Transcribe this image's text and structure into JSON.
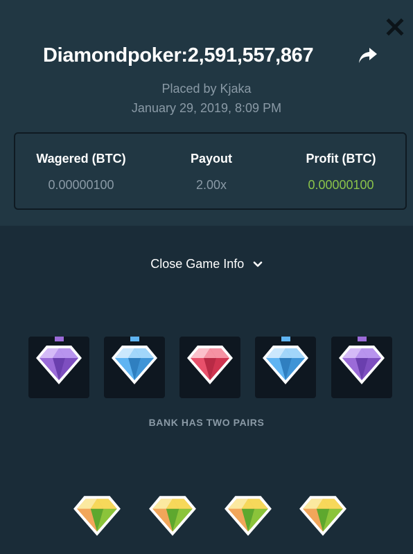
{
  "header": {
    "title": "Diamondpoker:2,591,557,867",
    "placed_by": "Placed by Kjaka",
    "date": "January 29, 2019, 8:09 PM"
  },
  "stats": {
    "wagered_label": "Wagered (BTC)",
    "wagered_value": "0.00000100",
    "payout_label": "Payout",
    "payout_value": "2.00x",
    "profit_label": "Profit (BTC)",
    "profit_value": "0.00000100"
  },
  "toggle": {
    "label": "Close Game Info"
  },
  "bank": {
    "label": "BANK HAS TWO PAIRS",
    "gems": [
      "purple",
      "blue",
      "red",
      "blue",
      "purple"
    ]
  },
  "player": {
    "gems": [
      "yellow",
      "yellow",
      "yellow",
      "yellow"
    ]
  },
  "colors": {
    "background": "#1a2c38",
    "panel": "#213743",
    "profit_green": "#8bc34a",
    "muted_text": "#8a9aa6",
    "purple": "#9b6bd8",
    "blue": "#5fb4f2",
    "red": "#e8506b",
    "yellow": "#f2c230"
  },
  "icons": {
    "close": "close-icon",
    "share": "share-arrow-icon",
    "chevron": "chevron-down-icon",
    "gem": "diamond-gem-icon"
  }
}
